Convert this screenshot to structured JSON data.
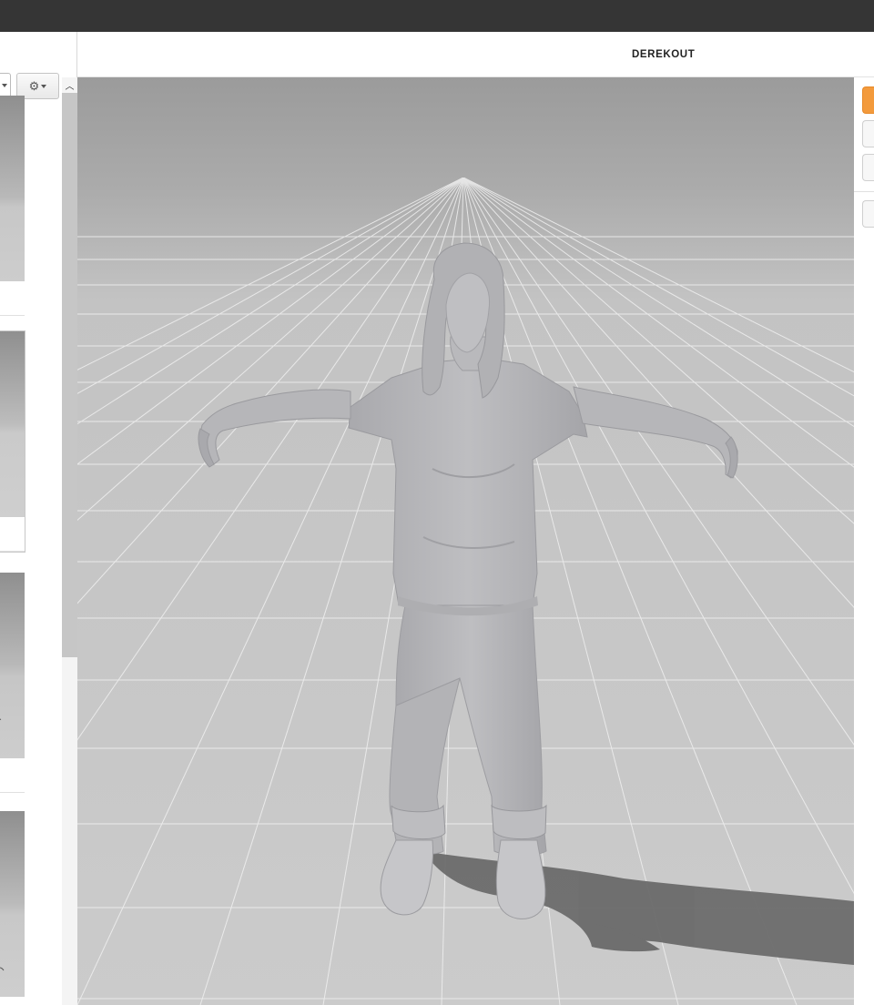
{
  "header": {
    "model_title": "DEREKOUT"
  },
  "toolbar": {
    "settings_icon": "gear-icon",
    "settings_caret_icon": "caret-down-icon",
    "dropdown_caret_icon": "caret-down-icon"
  },
  "sidebar": {
    "scroll_up_icon": "chevron-up-icon",
    "thumbnails": [
      {
        "name": "thumbnail-1",
        "selected": false
      },
      {
        "name": "thumbnail-2",
        "selected": true
      },
      {
        "name": "thumbnail-3",
        "selected": false
      },
      {
        "name": "thumbnail-4",
        "selected": false
      }
    ]
  },
  "right_panel": {
    "buttons": [
      {
        "name": "view-mode-button-1",
        "active": true
      },
      {
        "name": "view-mode-button-2",
        "active": false
      },
      {
        "name": "view-mode-button-3",
        "active": false
      },
      {
        "name": "view-mode-button-4",
        "active": false
      }
    ]
  },
  "colors": {
    "titlebar": "#353535",
    "accent": "#f39a3c",
    "model_fill": "#b8b8bb",
    "floor": "#c9c9c9",
    "grid_line": "#f2f2f2",
    "shadow": "#6a6a6a"
  }
}
